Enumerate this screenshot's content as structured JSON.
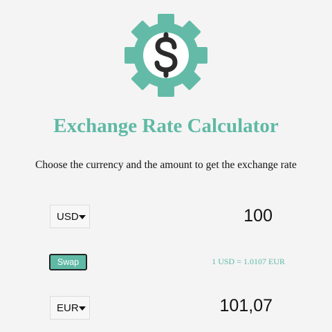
{
  "header": {
    "title": "Exchange Rate Calculator",
    "subtitle": "Choose the currency and the amount to get the exchange rate",
    "logo_icon": "gear-dollar-icon"
  },
  "currency_one": {
    "selected": "USD",
    "amount": "100"
  },
  "currency_two": {
    "selected": "EUR",
    "amount": "101,07"
  },
  "swap": {
    "label": "Swap",
    "rate_text": "1 USD = 1.0107 EUR"
  },
  "colors": {
    "accent": "#5fb9a5",
    "background": "#f4f4f4",
    "text": "#111111"
  }
}
